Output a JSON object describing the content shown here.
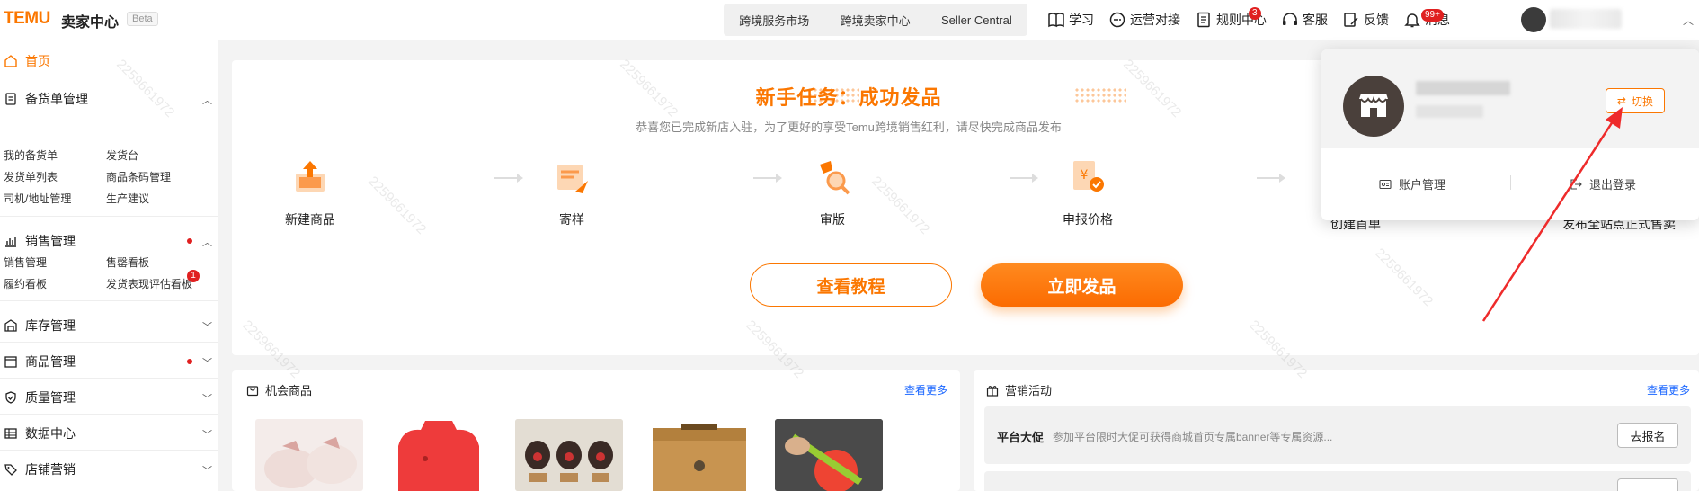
{
  "brand": {
    "logo": "TEMU",
    "subtitle": "卖家中心",
    "beta": "Beta"
  },
  "top_links": [
    "跨境服务市场",
    "跨境卖家中心",
    "Seller Central"
  ],
  "top_tools": [
    {
      "label": "学习",
      "icon": "book-icon"
    },
    {
      "label": "运营对接",
      "icon": "chat-icon"
    },
    {
      "label": "规则中心",
      "icon": "document-icon",
      "badge": "3"
    },
    {
      "label": "客服",
      "icon": "headset-icon"
    },
    {
      "label": "反馈",
      "icon": "edit-icon"
    },
    {
      "label": "消息",
      "icon": "bell-icon",
      "badge": "99+"
    }
  ],
  "sidebar": {
    "home": "首页",
    "sections": [
      {
        "label": "备货单管理",
        "expanded": true,
        "items": [
          "我的备货单",
          "发货台",
          "发货单列表",
          "商品条码管理",
          "司机/地址管理",
          "生产建议"
        ]
      },
      {
        "label": "销售管理",
        "expanded": true,
        "dot": true,
        "items": [
          "销售管理",
          "售罄看板",
          "履约看板",
          "发货表现评估看板"
        ],
        "item_badge": "1"
      },
      {
        "label": "库存管理",
        "expanded": false
      },
      {
        "label": "商品管理",
        "expanded": false,
        "dot": true
      },
      {
        "label": "质量管理",
        "expanded": false
      },
      {
        "label": "数据中心",
        "expanded": false
      },
      {
        "label": "店铺营销",
        "expanded": false
      }
    ]
  },
  "task": {
    "title": "新手任务：成功发品",
    "subtitle": "恭喜您已完成新店入驻，为了更好的享受Temu跨境销售红利，请尽快完成商品发布",
    "steps": [
      "新建商品",
      "寄样",
      "审版",
      "申报价格",
      "创建首单",
      "发布全站点正式售卖"
    ],
    "btn_tutorial": "查看教程",
    "btn_publish": "立即发品"
  },
  "opportunity": {
    "title": "机会商品",
    "more": "查看更多"
  },
  "marketing": {
    "title": "营销活动",
    "more": "查看更多",
    "row": {
      "title": "平台大促",
      "desc": "参加平台限时大促可获得商城首页专属banner等专属资源...",
      "button": "去报名"
    }
  },
  "popup": {
    "switch": "切换",
    "account": "账户管理",
    "logout": "退出登录"
  },
  "watermark": "2259661972",
  "colors": {
    "brand": "#fb7701",
    "link": "#1a66ff",
    "badge": "#e02020"
  }
}
